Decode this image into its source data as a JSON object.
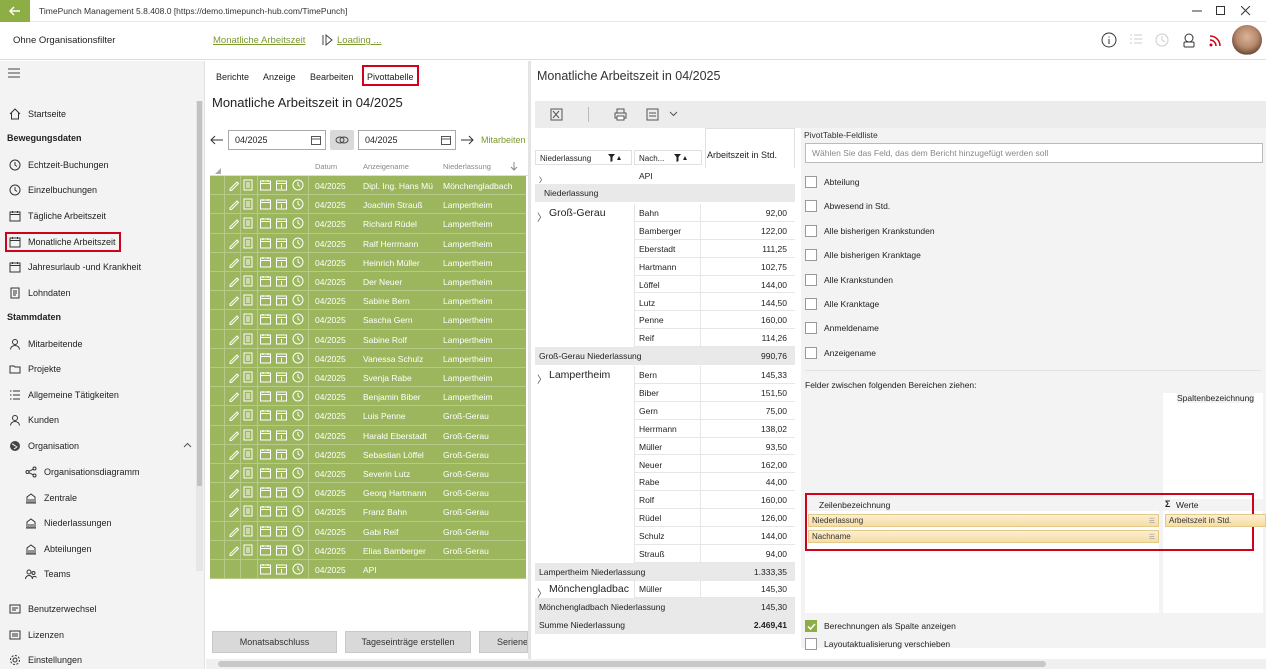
{
  "window": {
    "title": "TimePunch Management 5.8.408.0 [https://demo.timepunch-hub.com/TimePunch]"
  },
  "header": {
    "org_filter": "Ohne Organisationsfilter",
    "breadcrumb": "Monatliche Arbeitszeit",
    "loading": "Loading ..."
  },
  "sidebar": {
    "items": [
      {
        "label": "Startseite",
        "icon": "home-icon"
      },
      {
        "section": "Bewegungsdaten"
      },
      {
        "label": "Echtzeit-Buchungen",
        "icon": "clock-icon"
      },
      {
        "label": "Einzelbuchungen",
        "icon": "clock-icon"
      },
      {
        "label": "Tägliche Arbeitszeit",
        "icon": "calendar-icon"
      },
      {
        "label": "Monatliche Arbeitszeit",
        "icon": "calendar-icon",
        "selected": true
      },
      {
        "label": "Jahresurlaub -und Krankheit",
        "icon": "calendar-icon"
      },
      {
        "label": "Lohndaten",
        "icon": "document-icon"
      },
      {
        "section": "Stammdaten"
      },
      {
        "label": "Mitarbeitende",
        "icon": "person-icon"
      },
      {
        "label": "Projekte",
        "icon": "folder-icon"
      },
      {
        "label": "Allgemeine Tätigkeiten",
        "icon": "list-icon"
      },
      {
        "label": "Kunden",
        "icon": "person-icon"
      },
      {
        "label": "Organisation",
        "icon": "globe-icon"
      },
      {
        "label": "Organisationsdiagramm",
        "icon": "share-icon",
        "sub": true
      },
      {
        "label": "Zentrale",
        "icon": "building-icon",
        "sub": true
      },
      {
        "label": "Niederlassungen",
        "icon": "building-icon",
        "sub": true
      },
      {
        "label": "Abteilungen",
        "icon": "building-icon",
        "sub": true
      },
      {
        "label": "Teams",
        "icon": "team-icon",
        "sub": true
      },
      {
        "label": "Benutzerwechsel",
        "icon": "switch-icon"
      },
      {
        "label": "Lizenzen",
        "icon": "key-icon"
      },
      {
        "label": "Einstellungen",
        "icon": "gear-icon"
      }
    ]
  },
  "middle": {
    "menu": [
      "Berichte",
      "Anzeige",
      "Bearbeiten",
      "Pivottabelle"
    ],
    "title": "Monatliche Arbeitszeit in 04/2025",
    "date_from": "04/2025",
    "date_to": "04/2025",
    "mitarbeiter_link": "Mitarbeiten",
    "columns": {
      "datum": "Datum",
      "anzeigename": "Anzeigename",
      "niederlassung": "Niederlassung"
    },
    "rows": [
      {
        "datum": "04/2025",
        "name": "Dipl. Ing. Hans Mü",
        "nl": "Mönchengladbach"
      },
      {
        "datum": "04/2025",
        "name": "Joachim Strauß",
        "nl": "Lampertheim"
      },
      {
        "datum": "04/2025",
        "name": "Richard Rüdel",
        "nl": "Lampertheim"
      },
      {
        "datum": "04/2025",
        "name": "Ralf Herrmann",
        "nl": "Lampertheim"
      },
      {
        "datum": "04/2025",
        "name": "Heinrich Müller",
        "nl": "Lampertheim"
      },
      {
        "datum": "04/2025",
        "name": "Der Neuer",
        "nl": "Lampertheim"
      },
      {
        "datum": "04/2025",
        "name": "Sabine Bern",
        "nl": "Lampertheim"
      },
      {
        "datum": "04/2025",
        "name": "Sascha Gern",
        "nl": "Lampertheim"
      },
      {
        "datum": "04/2025",
        "name": "Sabine Rolf",
        "nl": "Lampertheim"
      },
      {
        "datum": "04/2025",
        "name": "Vanessa Schulz",
        "nl": "Lampertheim"
      },
      {
        "datum": "04/2025",
        "name": "Svenja Rabe",
        "nl": "Lampertheim"
      },
      {
        "datum": "04/2025",
        "name": "Benjamin Biber",
        "nl": "Lampertheim"
      },
      {
        "datum": "04/2025",
        "name": "Luis Penne",
        "nl": "Groß-Gerau"
      },
      {
        "datum": "04/2025",
        "name": "Harald Eberstadt",
        "nl": "Groß-Gerau"
      },
      {
        "datum": "04/2025",
        "name": "Sebastian Löffel",
        "nl": "Groß-Gerau"
      },
      {
        "datum": "04/2025",
        "name": "Severin Lutz",
        "nl": "Groß-Gerau"
      },
      {
        "datum": "04/2025",
        "name": "Georg Hartmann",
        "nl": "Groß-Gerau"
      },
      {
        "datum": "04/2025",
        "name": "Franz Bahn",
        "nl": "Groß-Gerau"
      },
      {
        "datum": "04/2025",
        "name": "Gabi Reif",
        "nl": "Groß-Gerau"
      },
      {
        "datum": "04/2025",
        "name": "Elias Bamberger",
        "nl": "Groß-Gerau"
      },
      {
        "datum": "04/2025",
        "name": "API",
        "nl": ""
      }
    ],
    "buttons": [
      "Monatsabschluss",
      "Tageseinträge erstellen",
      "Seriene"
    ]
  },
  "right": {
    "title": "Monatliche Arbeitszeit in 04/2025",
    "pivot": {
      "filter_niederlassung": "Niederlassung",
      "filter_nachname": "Nach...",
      "value_header": "Arbeitszeit in Std.",
      "api_row": "API",
      "nl_header": "Niederlassung",
      "groups": [
        {
          "name": "Groß-Gerau",
          "rows": [
            [
              "Bahn",
              "92,00"
            ],
            [
              "Bamberger",
              "122,00"
            ],
            [
              "Eberstadt",
              "111,25"
            ],
            [
              "Hartmann",
              "102,75"
            ],
            [
              "Löffel",
              "144,00"
            ],
            [
              "Lutz",
              "144,50"
            ],
            [
              "Penne",
              "160,00"
            ],
            [
              "Reif",
              "114,26"
            ]
          ],
          "subtotal_label": "Groß-Gerau Niederlassung",
          "subtotal": "990,76"
        },
        {
          "name": "Lampertheim",
          "rows": [
            [
              "Bern",
              "145,33"
            ],
            [
              "Biber",
              "151,50"
            ],
            [
              "Gern",
              "75,00"
            ],
            [
              "Herrmann",
              "138,02"
            ],
            [
              "Müller",
              "93,50"
            ],
            [
              "Neuer",
              "162,00"
            ],
            [
              "Rabe",
              "44,00"
            ],
            [
              "Rolf",
              "160,00"
            ],
            [
              "Rüdel",
              "126,00"
            ],
            [
              "Schulz",
              "144,00"
            ],
            [
              "Strauß",
              "94,00"
            ]
          ],
          "subtotal_label": "Lampertheim Niederlassung",
          "subtotal": "1.333,35"
        },
        {
          "name": "Mönchengladbac",
          "rows": [
            [
              "Müller",
              "145,30"
            ]
          ],
          "subtotal_label": "Mönchengladbach Niederlassung",
          "subtotal": "145,30"
        }
      ],
      "total_label": "Summe Niederlassung",
      "total": "2.469,41"
    },
    "fieldlist": {
      "title": "PivotTable-Feldliste",
      "search_placeholder": "Wählen Sie das Feld, das dem Bericht hinzugefügt werden soll",
      "fields": [
        "Abteilung",
        "Abwesend in Std.",
        "Alle bisherigen Krankstunden",
        "Alle bisherigen Kranktage",
        "Alle Krankstunden",
        "Alle Kranktage",
        "Anmeldename",
        "Anzeigename"
      ],
      "drag_hint": "Felder zwischen folgenden Bereichen ziehen:",
      "col_label": "Spaltenbezeichnung",
      "row_label": "Zeilenbezeichnung",
      "values_label": "Werte",
      "row_chips": [
        "Niederlassung",
        "Nachname"
      ],
      "value_chip": "Arbeitszeit in Std.",
      "check_calc": "Berechnungen als Spalte anzeigen",
      "check_defer": "Layoutaktualisierung verschieben"
    }
  },
  "colors": {
    "accent": "#8cae45",
    "row_green": "#9cb65e",
    "highlight": "#d0021b"
  }
}
